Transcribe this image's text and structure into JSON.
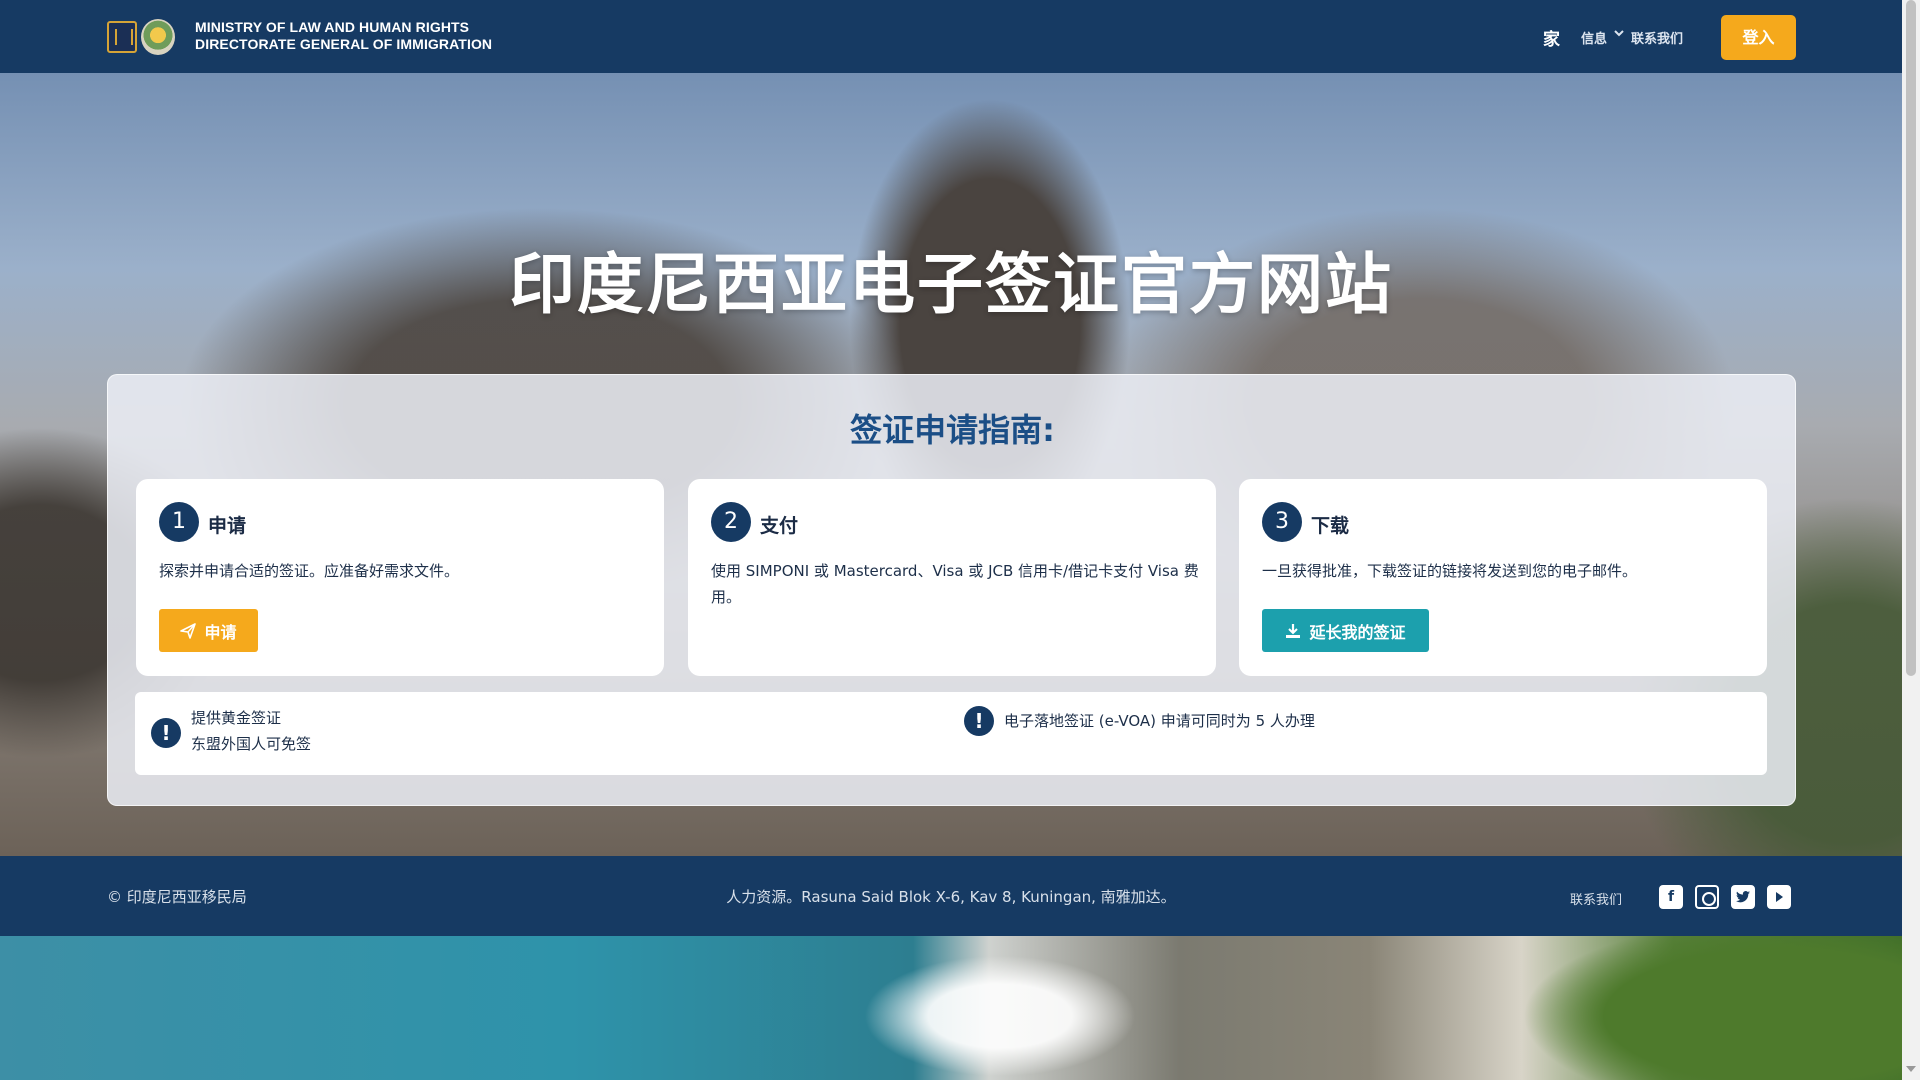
{
  "header": {
    "ministry_line1": "MINISTRY OF  LAW  AND HUMAN RIGHTS",
    "ministry_line2": "DIRECTORATE GENERAL OF IMMIGRATION",
    "nav": {
      "home": "家",
      "info": "信息",
      "contact": "联系我们",
      "login": "登入"
    }
  },
  "hero": {
    "title": "印度尼西亚电子签证官方网站"
  },
  "guide": {
    "title": "签证申请指南:",
    "steps": [
      {
        "number": "1",
        "title": "申请",
        "description": "探索并申请合适的签证。应准备好需求文件。",
        "button": "申请",
        "button_icon": "paper-plane-icon"
      },
      {
        "number": "2",
        "title": "支付",
        "description": "使用 SIMPONI 或 Mastercard、Visa 或 JCB 信用卡/借记卡支付 Visa 费用。"
      },
      {
        "number": "3",
        "title": "下载",
        "description": "一旦获得批准，下载签证的链接将发送到您的电子邮件。",
        "button": "延长我的签证",
        "button_icon": "download-icon"
      }
    ],
    "notices": {
      "left_line1": "提供黄金签证",
      "left_line2": "东盟外国人可免签",
      "right": "电子落地签证 (e-VOA) 申请可同时为 5 人办理"
    }
  },
  "footer": {
    "copyright": "© 印度尼西亚移民局",
    "address": "人力资源。Rasuna Said Blok X-6, Kav 8, Kuningan, 南雅加达。",
    "contact": "联系我们",
    "social": [
      "facebook-icon",
      "instagram-icon",
      "twitter-icon",
      "youtube-icon"
    ]
  },
  "colors": {
    "navy": "#163a63",
    "accent_orange": "#f5a91c",
    "accent_teal": "#1ca0ad",
    "title_blue": "#1b4e86"
  }
}
